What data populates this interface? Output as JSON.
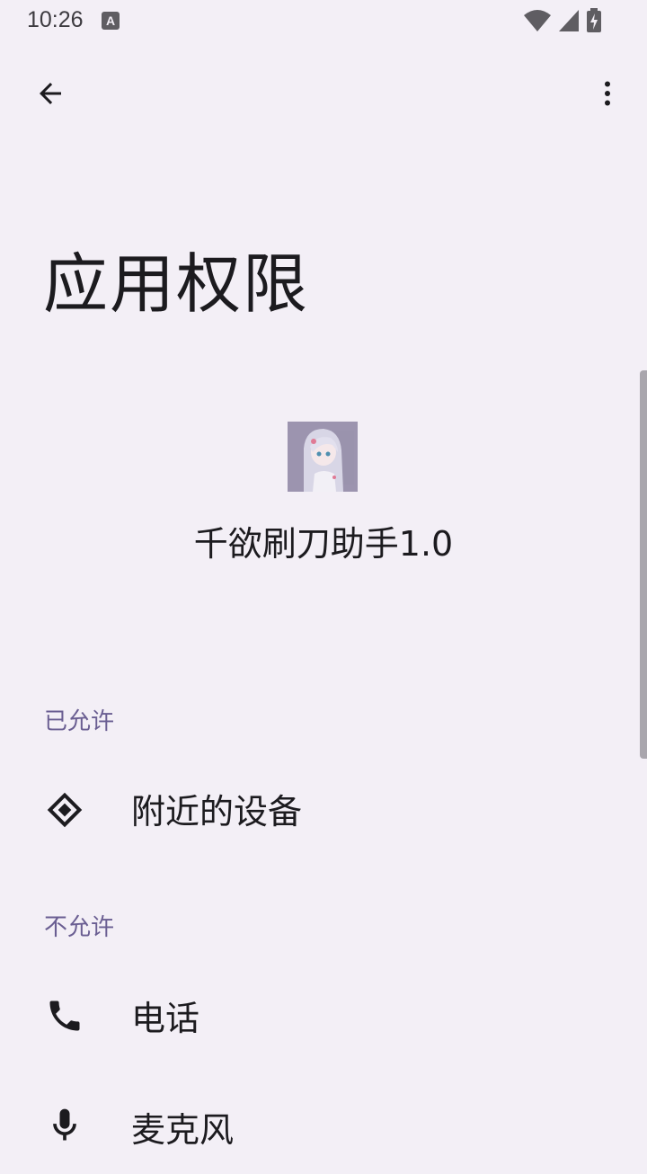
{
  "status_bar": {
    "time": "10:26",
    "notification_letter": "A",
    "icons": [
      "wifi-icon",
      "cell-signal-icon",
      "battery-charging-icon"
    ]
  },
  "app_bar": {
    "back_icon": "arrow-back-icon",
    "more_icon": "more-vert-icon"
  },
  "page": {
    "title": "应用权限"
  },
  "app": {
    "name": "千欲刷刀助手1.0",
    "icon": "app-icon"
  },
  "sections": {
    "allowed": {
      "header": "已允许",
      "items": [
        {
          "label": "附近的设备",
          "icon": "nearby-devices-icon"
        }
      ]
    },
    "denied": {
      "header": "不允许",
      "items": [
        {
          "label": "电话",
          "icon": "phone-icon"
        },
        {
          "label": "麦克风",
          "icon": "microphone-icon"
        }
      ]
    }
  },
  "colors": {
    "background": "#f3eff6",
    "section_header": "#6a5e92",
    "text": "#1c1b1f"
  }
}
